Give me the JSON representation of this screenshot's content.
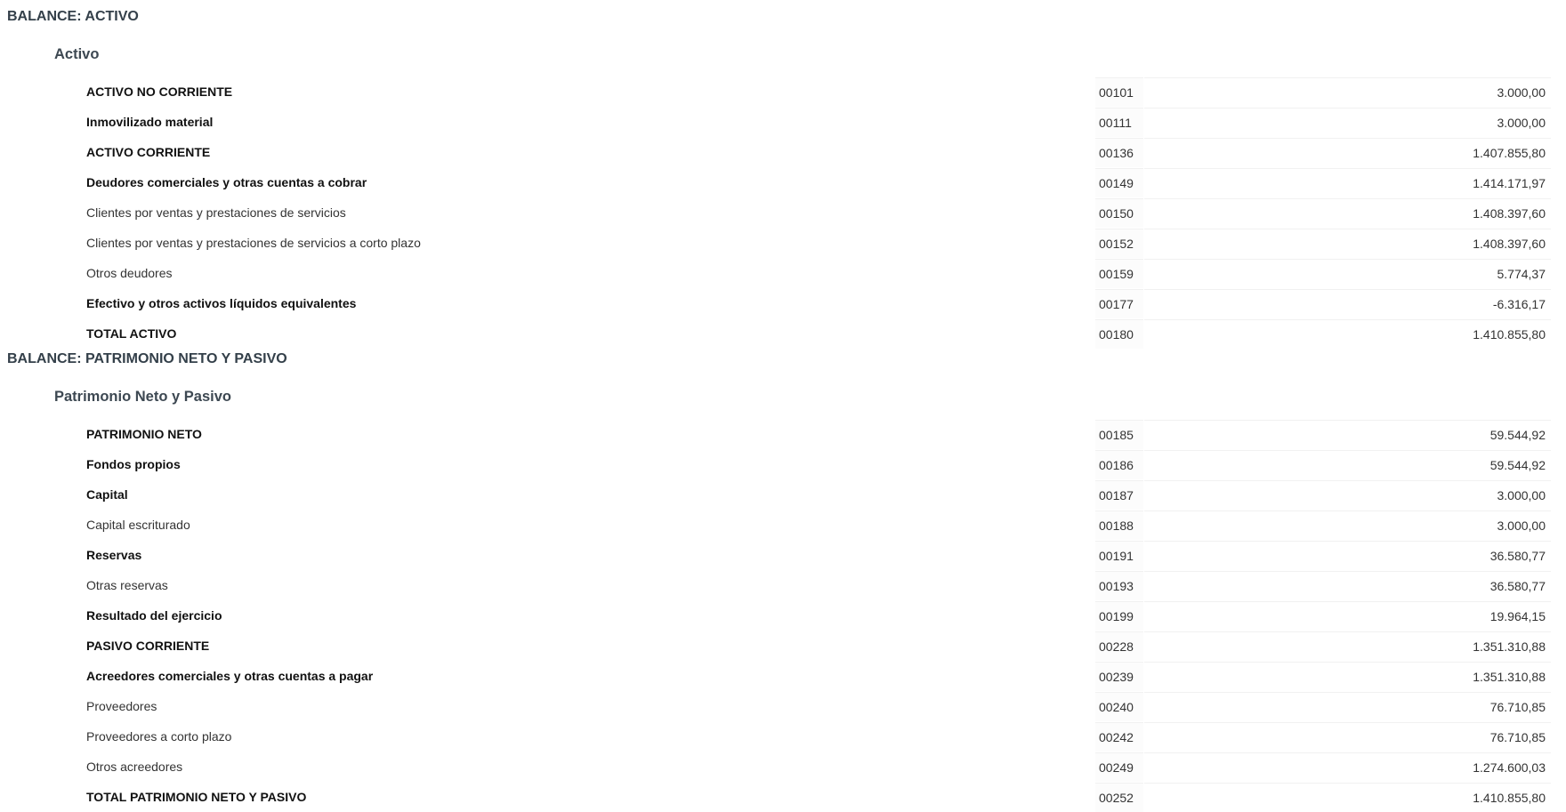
{
  "sections": [
    {
      "title": "BALANCE: ACTIVO",
      "subtitle": "Activo",
      "rows": [
        {
          "label": "ACTIVO NO CORRIENTE",
          "code": "00101",
          "amount": "3.000,00",
          "bold": true
        },
        {
          "label": "Inmovilizado material",
          "code": "00111",
          "amount": "3.000,00",
          "bold": true
        },
        {
          "label": "ACTIVO CORRIENTE",
          "code": "00136",
          "amount": "1.407.855,80",
          "bold": true
        },
        {
          "label": "Deudores comerciales y otras cuentas a cobrar",
          "code": "00149",
          "amount": "1.414.171,97",
          "bold": true
        },
        {
          "label": "Clientes por ventas y prestaciones de servicios",
          "code": "00150",
          "amount": "1.408.397,60",
          "bold": false
        },
        {
          "label": "Clientes por ventas y prestaciones de servicios a corto plazo",
          "code": "00152",
          "amount": "1.408.397,60",
          "bold": false
        },
        {
          "label": "Otros deudores",
          "code": "00159",
          "amount": "5.774,37",
          "bold": false
        },
        {
          "label": "Efectivo y otros activos líquidos equivalentes",
          "code": "00177",
          "amount": "-6.316,17",
          "bold": true
        },
        {
          "label": "TOTAL ACTIVO",
          "code": "00180",
          "amount": "1.410.855,80",
          "bold": true
        }
      ]
    },
    {
      "title": "BALANCE: PATRIMONIO NETO Y PASIVO",
      "subtitle": "Patrimonio Neto y Pasivo",
      "rows": [
        {
          "label": "PATRIMONIO NETO",
          "code": "00185",
          "amount": "59.544,92",
          "bold": true
        },
        {
          "label": "Fondos propios",
          "code": "00186",
          "amount": "59.544,92",
          "bold": true
        },
        {
          "label": "Capital",
          "code": "00187",
          "amount": "3.000,00",
          "bold": true
        },
        {
          "label": "Capital escriturado",
          "code": "00188",
          "amount": "3.000,00",
          "bold": false
        },
        {
          "label": "Reservas",
          "code": "00191",
          "amount": "36.580,77",
          "bold": true
        },
        {
          "label": "Otras reservas",
          "code": "00193",
          "amount": "36.580,77",
          "bold": false
        },
        {
          "label": "Resultado del ejercicio",
          "code": "00199",
          "amount": "19.964,15",
          "bold": true
        },
        {
          "label": "PASIVO CORRIENTE",
          "code": "00228",
          "amount": "1.351.310,88",
          "bold": true
        },
        {
          "label": "Acreedores comerciales y otras cuentas a pagar",
          "code": "00239",
          "amount": "1.351.310,88",
          "bold": true
        },
        {
          "label": "Proveedores",
          "code": "00240",
          "amount": "76.710,85",
          "bold": false
        },
        {
          "label": "Proveedores a corto plazo",
          "code": "00242",
          "amount": "76.710,85",
          "bold": false
        },
        {
          "label": "Otros acreedores",
          "code": "00249",
          "amount": "1.274.600,03",
          "bold": false
        },
        {
          "label": "TOTAL PATRIMONIO NETO Y PASIVO",
          "code": "00252",
          "amount": "1.410.855,80",
          "bold": true
        }
      ]
    }
  ]
}
